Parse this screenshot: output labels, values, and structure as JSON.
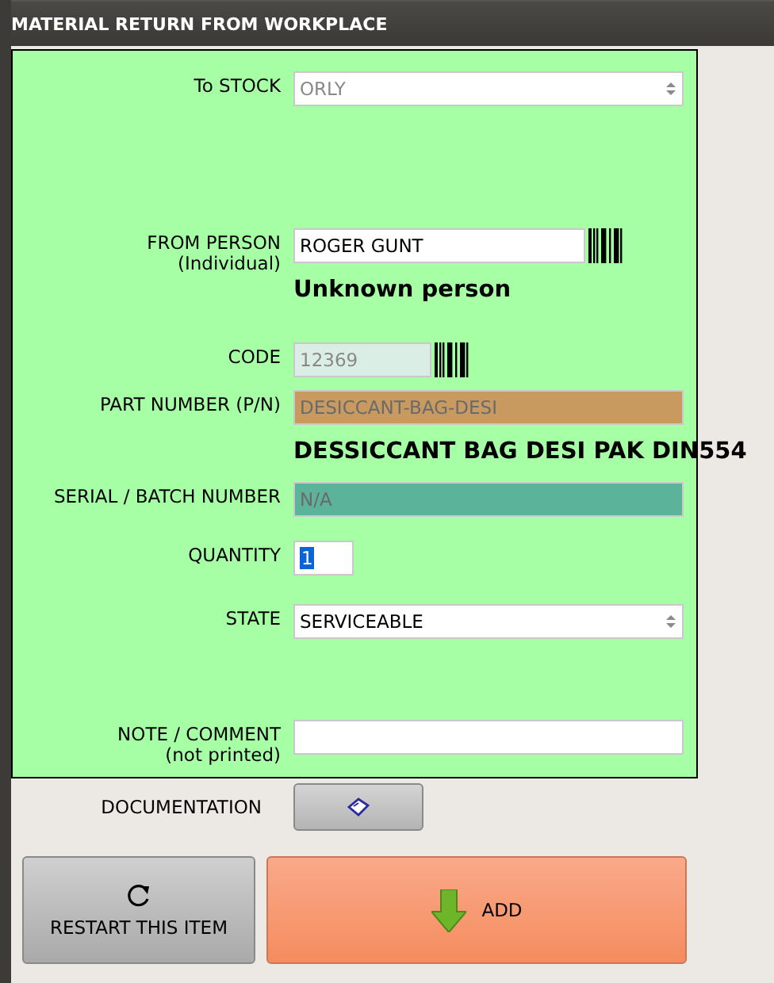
{
  "window": {
    "title": "MATERIAL RETURN FROM WORKPLACE"
  },
  "fields": [
    {
      "kind": "select",
      "label": "To STOCK",
      "value": "ORLY",
      "disabled": true
    },
    {
      "kind": "barcode",
      "label": "FROM PERSON",
      "sublabel": "(Individual)",
      "value": "ROGER GUNT",
      "disabled": false,
      "note": "Unknown person"
    },
    {
      "kind": "barcode",
      "label": "CODE",
      "value": "12369",
      "disabled": true
    },
    {
      "kind": "colored",
      "label": "PART NUMBER (P/N)",
      "value": "DESICCANT-BAG-DESI",
      "color": "#c89a60",
      "note": "DESSICCANT BAG DESI PAK DIN554"
    },
    {
      "kind": "colored",
      "label": "SERIAL / BATCH NUMBER",
      "value": "N/A",
      "color": "#5bb39a"
    },
    {
      "kind": "number",
      "label": "QUANTITY",
      "value": "1"
    },
    {
      "kind": "select",
      "label": "STATE",
      "value": "SERVICEABLE",
      "disabled": false
    },
    {
      "kind": "text",
      "label": "NOTE / COMMENT",
      "sublabel": "(not printed)"
    }
  ],
  "documentation": {
    "label": "DOCUMENTATION"
  },
  "buttons": [
    {
      "kind": "restart",
      "label": "RESTART THIS ITEM"
    },
    {
      "kind": "add",
      "label": "ADD"
    }
  ]
}
